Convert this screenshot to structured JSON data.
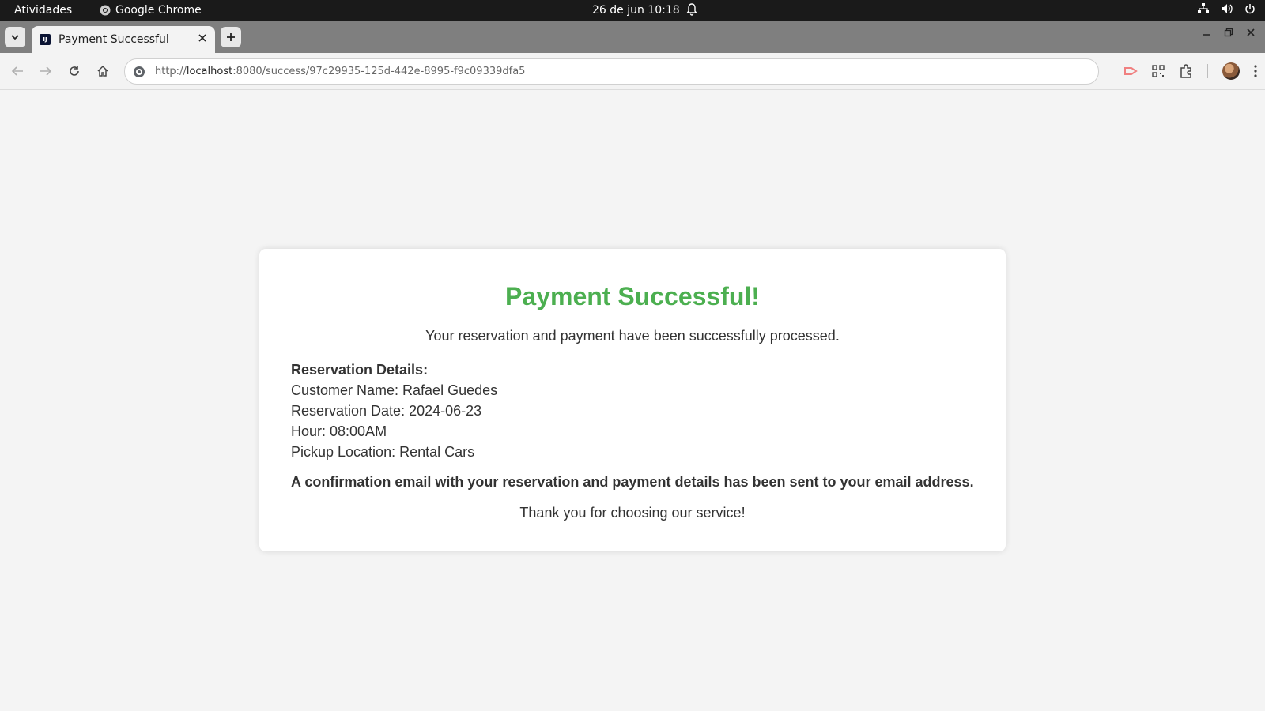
{
  "os_topbar": {
    "activities": "Atividades",
    "app_name": "Google Chrome",
    "clock": "26 de jun  10:18"
  },
  "browser": {
    "tab": {
      "title": "Payment Successful",
      "favicon_letter": "IJ"
    },
    "url": {
      "scheme": "http://",
      "host": "localhost",
      "rest": ":8080/success/97c29935-125d-442e-8995-f9c09339dfa5"
    }
  },
  "page": {
    "title": "Payment Successful!",
    "lead": "Your reservation and payment have been successfully processed.",
    "details": {
      "heading": "Reservation Details:",
      "customer": "Customer Name: Rafael Guedes",
      "date": "Reservation Date: 2024-06-23",
      "hour": "Hour: 08:00AM",
      "location": "Pickup Location: Rental Cars"
    },
    "confirmation": "A confirmation email with your reservation and payment details has been sent to your email address.",
    "thanks": "Thank you for choosing our service!"
  },
  "colors": {
    "success_green": "#4caf50",
    "text": "#333333",
    "page_bg": "#f4f4f4"
  }
}
